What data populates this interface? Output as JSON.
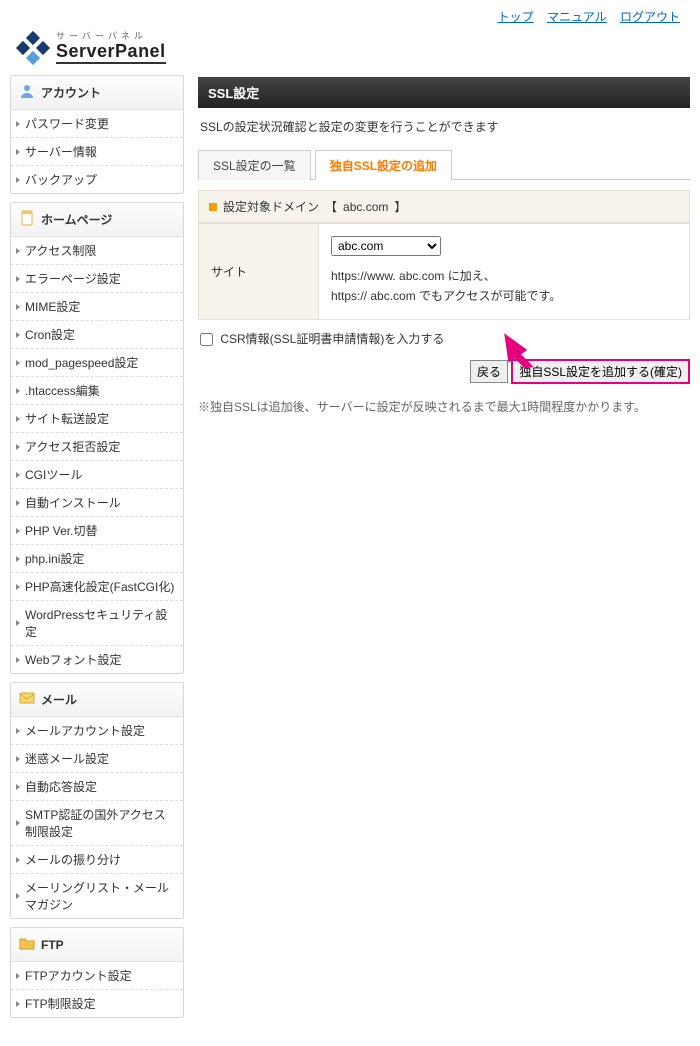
{
  "toplinks": {
    "top": "トップ",
    "manual": "マニュアル",
    "logout": "ログアウト"
  },
  "logo": {
    "sub": "サーバーパネル",
    "main": "ServerPanel"
  },
  "sidebar": {
    "sections": [
      {
        "title": "アカウント",
        "icon": "user",
        "items": [
          "パスワード変更",
          "サーバー情報",
          "バックアップ"
        ]
      },
      {
        "title": "ホームページ",
        "icon": "page",
        "items": [
          "アクセス制限",
          "エラーページ設定",
          "MIME設定",
          "Cron設定",
          "mod_pagespeed設定",
          ".htaccess編集",
          "サイト転送設定",
          "アクセス拒否設定",
          "CGIツール",
          "自動インストール",
          "PHP Ver.切替",
          "php.ini設定",
          "PHP高速化設定(FastCGI化)",
          "WordPressセキュリティ設定",
          "Webフォント設定"
        ]
      },
      {
        "title": "メール",
        "icon": "mail",
        "items": [
          "メールアカウント設定",
          "迷惑メール設定",
          "自動応答設定",
          "SMTP認証の国外アクセス制限設定",
          "メールの振り分け",
          "メーリングリスト・メールマガジン"
        ]
      },
      {
        "title": "FTP",
        "icon": "folder",
        "items": [
          "FTPアカウント設定",
          "FTP制限設定"
        ]
      }
    ]
  },
  "page": {
    "title": "SSL設定",
    "desc": "SSLの設定状況確認と設定の変更を行うことができます"
  },
  "tabs": [
    {
      "label": "SSL設定の一覧",
      "active": false
    },
    {
      "label": "独自SSL設定の追加",
      "active": true
    }
  ],
  "domainbar": {
    "label": "設定対象ドメイン",
    "value": "abc.com"
  },
  "form": {
    "site_label": "サイト",
    "select_value": "abc.com",
    "note_line1": "https://www. abc.com   に加え、",
    "note_line2": "https:// abc.com   でもアクセスが可能です。"
  },
  "csr": {
    "label": "CSR情報(SSL証明書申請情報)を入力する"
  },
  "buttons": {
    "back": "戻る",
    "submit": "独自SSL設定を追加する(確定)"
  },
  "note": "※独自SSLは追加後、サーバーに設定が反映されるまで最大1時間程度かかります。"
}
